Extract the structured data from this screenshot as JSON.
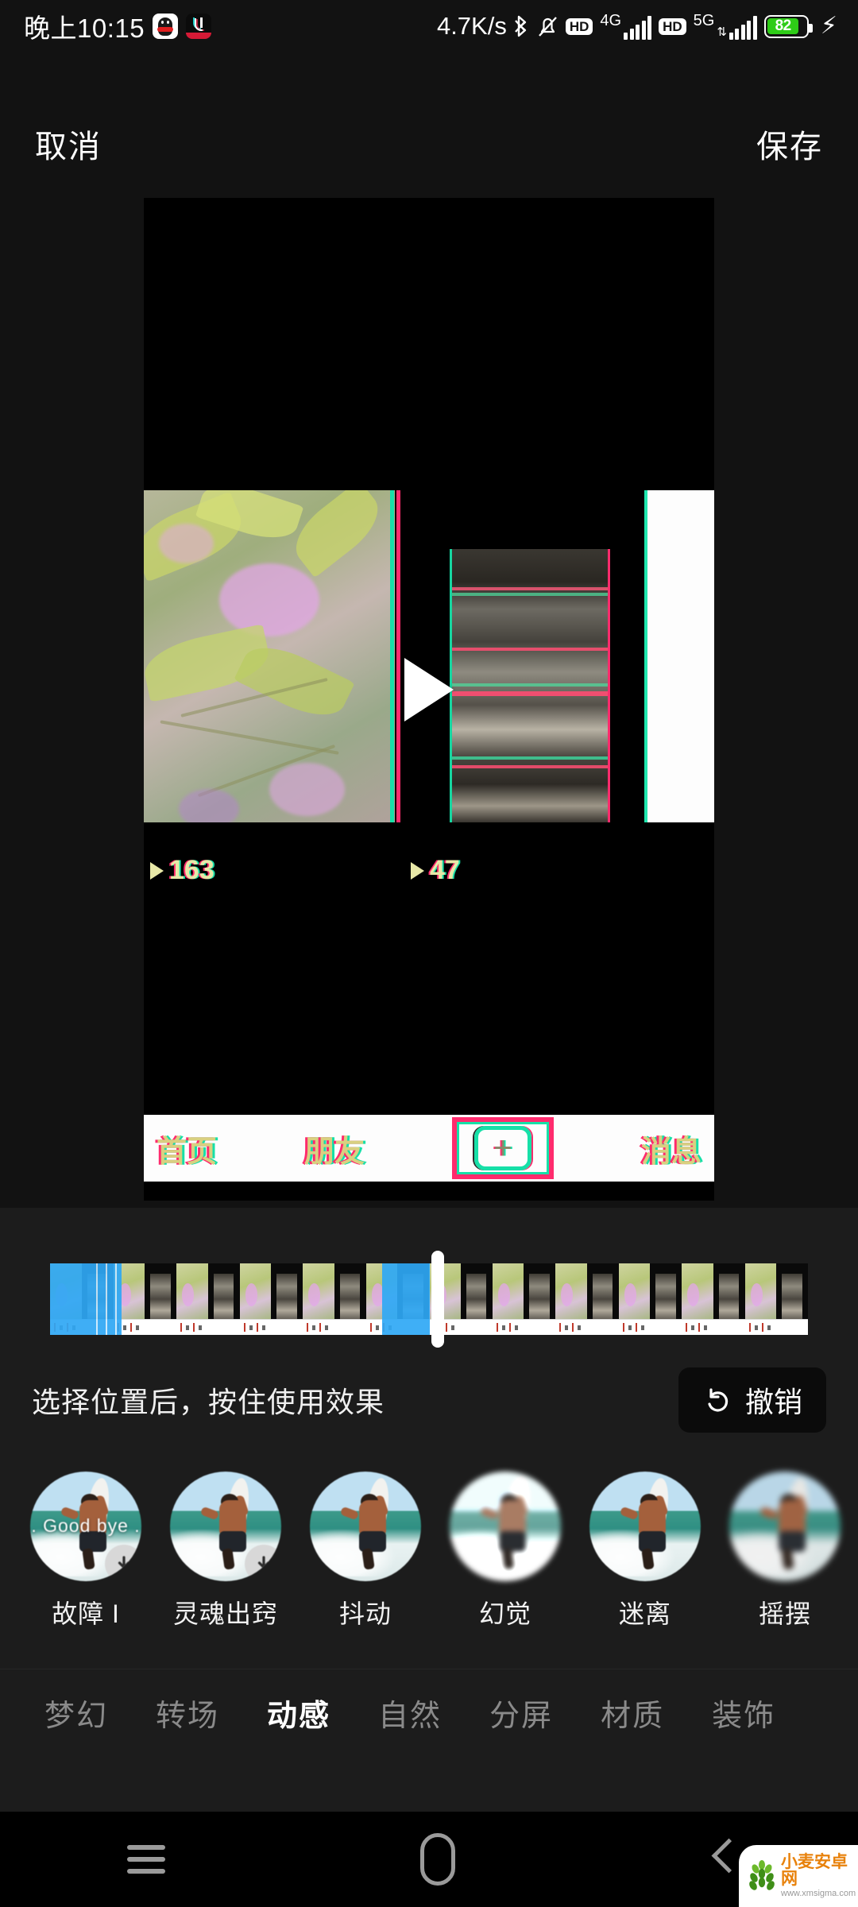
{
  "status_bar": {
    "time": "晚上10:15",
    "app_icons": [
      "qq-icon",
      "tiktok-icon"
    ],
    "net_speed": "4.7K/s",
    "bluetooth_icon": "bluetooth-icon",
    "mute_icon": "mute-bell-icon",
    "sim1": {
      "hd_label": "HD",
      "network_label": "4G",
      "bars": 5
    },
    "sim2": {
      "hd_label": "HD",
      "network_label": "5G",
      "bars": 5
    },
    "battery": {
      "level": "82",
      "charging_icon": "charging-bolt-icon",
      "color": "#2ecc17"
    }
  },
  "top_bar": {
    "cancel_label": "取消",
    "save_label": "保存"
  },
  "preview": {
    "left_clip_views": "163",
    "right_clip_views": "47",
    "play_icon": "play-triangle-icon",
    "inner_nav": {
      "home_label": "首页",
      "friends_label": "朋友",
      "add_icon": "plus-icon",
      "messages_label": "消息"
    },
    "effect_colors": {
      "cyan": "#16e0a8",
      "magenta": "#ff2b6d"
    }
  },
  "timeline": {
    "frame_count": 12,
    "selected_color": "#2fa8f5",
    "playhead_position_pct": 50,
    "segments": [
      {
        "start_pct": 0,
        "width_pct": 9
      },
      {
        "start_pct": 43.8,
        "width_pct": 6.3
      }
    ]
  },
  "hint": {
    "text": "选择位置后，按住使用效果",
    "undo_label": "撤销",
    "undo_icon": "undo-arrow-icon"
  },
  "effects": [
    {
      "label": "故障 I",
      "overlay_text": ". Good  bye .",
      "has_download_badge": true,
      "style": "mild"
    },
    {
      "label": "灵魂出窍",
      "overlay_text": "",
      "has_download_badge": true,
      "style": "mild"
    },
    {
      "label": "抖动",
      "overlay_text": "",
      "has_download_badge": false,
      "style": "mild"
    },
    {
      "label": "幻觉",
      "overlay_text": "",
      "has_download_badge": false,
      "style": "soft"
    },
    {
      "label": "迷离",
      "overlay_text": "",
      "has_download_badge": false,
      "style": "mild"
    },
    {
      "label": "摇摆",
      "overlay_text": "",
      "has_download_badge": false,
      "style": "heavy"
    }
  ],
  "category_tabs": [
    {
      "label": "梦幻",
      "active": false
    },
    {
      "label": "转场",
      "active": false
    },
    {
      "label": "动感",
      "active": true
    },
    {
      "label": "自然",
      "active": false
    },
    {
      "label": "分屏",
      "active": false
    },
    {
      "label": "材质",
      "active": false
    },
    {
      "label": "装饰",
      "active": false
    }
  ],
  "android_nav": {
    "recents_icon": "menu-icon",
    "home_icon": "home-icon",
    "back_icon": "back-chevron-icon"
  },
  "watermark": {
    "name": "小麦安卓网",
    "url": "www.xmsigma.com",
    "logo_icon": "wheat-logo-icon"
  }
}
